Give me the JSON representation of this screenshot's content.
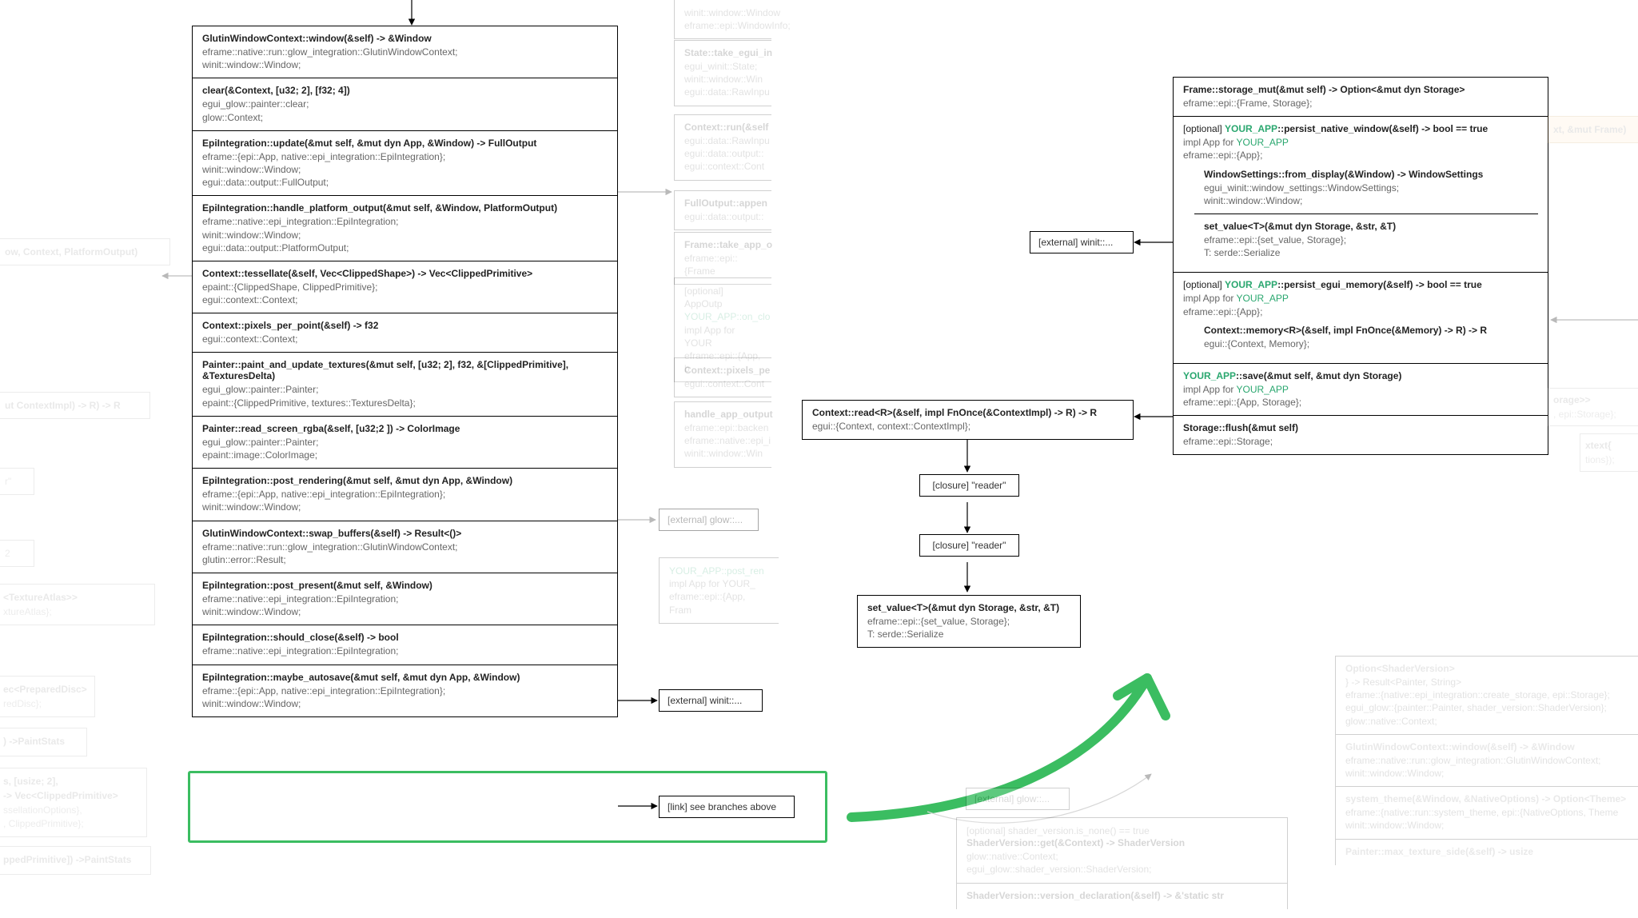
{
  "main_stack": {
    "cells": [
      {
        "sig": "GlutinWindowContext::window(&self) -> &Window",
        "details": [
          "eframe::native::run::glow_integration::GlutinWindowContext;",
          "winit::window::Window;"
        ]
      },
      {
        "sig": "clear(&Context, [u32; 2], [f32; 4])",
        "details": [
          "egui_glow::painter::clear;",
          "glow::Context;"
        ]
      },
      {
        "sig": "EpiIntegration::update(&mut self, &mut dyn App, &Window) -> FullOutput",
        "details": [
          "eframe::{epi::App, native::epi_integration::EpiIntegration};",
          "winit::window::Window;",
          "egui::data::output::FullOutput;"
        ]
      },
      {
        "sig": "EpiIntegration::handle_platform_output(&mut self, &Window, PlatformOutput)",
        "details": [
          "eframe::native::epi_integration::EpiIntegration;",
          "winit::window::Window;",
          "egui::data::output::PlatformOutput;"
        ]
      },
      {
        "sig": "Context::tessellate(&self, Vec<ClippedShape>) -> Vec<ClippedPrimitive>",
        "details": [
          "epaint::{ClippedShape, ClippedPrimitive};",
          "egui::context::Context;"
        ]
      },
      {
        "sig": "Context::pixels_per_point(&self) -> f32",
        "details": [
          "egui::context::Context;"
        ]
      },
      {
        "sig": "Painter::paint_and_update_textures(&mut self, [u32; 2], f32, &[ClippedPrimitive], &TexturesDelta)",
        "details": [
          "egui_glow::painter::Painter;",
          "epaint::{ClippedPrimitive, textures::TexturesDelta};"
        ]
      },
      {
        "sig": "Painter::read_screen_rgba(&self, [u32;2 ]) -> ColorImage",
        "details": [
          "egui_glow::painter::Painter;",
          "epaint::image::ColorImage;"
        ]
      },
      {
        "sig": "EpiIntegration::post_rendering(&mut self, &mut dyn App, &Window)",
        "details": [
          "eframe::{epi::App, native::epi_integration::EpiIntegration};",
          "winit::window::Window;"
        ]
      },
      {
        "sig": "GlutinWindowContext::swap_buffers(&self) -> Result<()>",
        "details": [
          "eframe::native::run::glow_integration::GlutinWindowContext;",
          "glutin::error::Result;"
        ]
      },
      {
        "sig": "EpiIntegration::post_present(&mut self, &Window)",
        "details": [
          "eframe::native::epi_integration::EpiIntegration;",
          "winit::window::Window;"
        ]
      },
      {
        "sig": "EpiIntegration::should_close(&self) -> bool",
        "details": [
          "eframe::native::epi_integration::EpiIntegration;"
        ]
      },
      {
        "sig": "EpiIntegration::maybe_autosave(&mut self, &mut dyn App, &Window)",
        "details": [
          "eframe::{epi::App, native::epi_integration::EpiIntegration};",
          "winit::window::Window;"
        ]
      }
    ]
  },
  "right_stack": {
    "cell0": {
      "sig": "Frame::storage_mut(&mut self) -> Option<&mut dyn Storage>",
      "details": [
        "eframe::epi::{Frame, Storage};"
      ]
    },
    "cell1": {
      "opt_prefix": "[optional] ",
      "app": "YOUR_APP",
      "tail": "::persist_native_window(&self) -> bool == true",
      "details": [
        "impl App for ",
        "eframe::epi::{App};"
      ]
    },
    "cell1b": {
      "sig": "WindowSettings::from_display(&Window) -> WindowSettings",
      "details": [
        "egui_winit::window_settings::WindowSettings;",
        "winit::window::Window;"
      ]
    },
    "cell1c": {
      "sig": "set_value<T>(&mut dyn Storage, &str, &T)",
      "details": [
        "eframe::epi::{set_value, Storage};",
        "T: serde::Serialize"
      ]
    },
    "cell2": {
      "opt_prefix": "[optional] ",
      "app": "YOUR_APP",
      "tail": "::persist_egui_memory(&self) -> bool == true",
      "details": [
        "impl App for ",
        "eframe::epi::{App};"
      ]
    },
    "cell2b": {
      "sig": "Context::memory<R>(&self, impl FnOnce(&Memory) -> R) -> R",
      "details": [
        "egui::{Context, Memory};"
      ]
    },
    "cell3": {
      "app": "YOUR_APP",
      "tail": "::save(&mut self, &mut dyn Storage)",
      "details": [
        "impl App for ",
        "eframe::epi::{App, Storage};"
      ]
    },
    "cell4": {
      "sig": "Storage::flush(&mut self)",
      "details": [
        "eframe::epi::Storage;"
      ]
    }
  },
  "mid_nodes": {
    "ext_winit1": "[external] winit::...",
    "ext_winit2": "[external] winit::...",
    "ext_glow": "[external] glow::...",
    "link_above": "[link] see branches above",
    "context_read": {
      "sig": "Context::read<R>(&self, impl FnOnce(&ContextImpl) -> R) -> R",
      "details": [
        "egui::{Context, context::ContextImpl};"
      ]
    },
    "closure1": "[closure] \"reader\"",
    "closure2": "[closure] \"reader\"",
    "set_value": {
      "sig": "set_value<T>(&mut dyn Storage, &str, &T)",
      "details": [
        "eframe::epi::{set_value, Storage};",
        "T: serde::Serialize"
      ]
    }
  },
  "faded_mid_column": {
    "a": [
      "winit::window::Window",
      "eframe::epi::WindowInfo;"
    ],
    "b": [
      "State::take_egui_in",
      "egui_winit::State;",
      "winit::window::Win",
      "egui::data::RawInpu"
    ],
    "c": [
      "Context::run(&self",
      "egui::data::RawInpu",
      "egui::data::output::",
      "egui::context::Cont"
    ],
    "d": [
      "FullOutput::appen",
      "egui::data::output::"
    ],
    "e": [
      "Frame::take_app_o",
      "eframe::epi::{Frame"
    ],
    "f": [
      "[optional] AppOutp",
      "YOUR_APP::on_clo",
      "impl App for YOUR",
      "eframe::epi::{App, b"
    ],
    "g": [
      "Context::pixels_pe",
      "egui::context::Cont"
    ],
    "h": [
      "handle_app_output",
      "eframe::epi::backen",
      "eframe::native::epi_i",
      "winit::window::Win"
    ],
    "i": [
      "YOUR_APP::post_ren",
      "impl App for YOUR_",
      "eframe::epi::{App, Fram"
    ]
  },
  "faded_left": {
    "a": "ow, Context, PlatformOutput)",
    "b": "ut ContextImpl) -> R) -> R",
    "c": "r\"",
    "d": "2",
    "e": [
      "<TextureAtlas>>",
      "xtureAtlas};"
    ],
    "f": [
      "ec<PreparedDisc>",
      "redDisc};"
    ],
    "g": [
      ") ->PaintStats"
    ],
    "h": [
      "s, [usize; 2],",
      "-> Vec<ClippedPrimitive>",
      "ssellationOptions},",
      ", ClippedPrimitive};"
    ],
    "i": [
      "ppedPrimitive]) ->PaintStats"
    ]
  },
  "faded_right": {
    "r0": "xt, &mut Frame)",
    "r1": [
      "orage>>",
      ", epi::Storage};"
    ],
    "r2": [
      "xtext{",
      "tions});"
    ],
    "a": [
      "        Option<ShaderVersion>",
      "} -> Result<Painter, String>",
      "eframe::{native::epi_integration::create_storage, epi::Storage};",
      "egui_glow::{painter::Painter, shader_version::ShaderVersion};",
      "glow::native::Context;"
    ],
    "b": [
      "GlutinWindowContext::window(&self) -> &Window",
      "eframe::native::run::glow_integration::GlutinWindowContext;",
      "winit::window::Window;"
    ],
    "c": [
      "system_theme(&Window, &NativeOptions) -> Option<Theme>",
      "eframe::{native::run::system_theme, epi::{NativeOptions, Theme",
      "winit::window::Window;"
    ],
    "d": [
      "Painter::max_texture_side(&self) -> usize"
    ]
  },
  "faded_bottom": {
    "glow": "[external] glow::...",
    "sv1": [
      "[optional] shader_version.is_none() == true",
      "ShaderVersion::get(&Context) -> ShaderVersion",
      "glow::native::Context;",
      "egui_glow::shader_version::ShaderVersion;"
    ],
    "sv2": [
      "ShaderVersion::version_declaration(&self) -> &'static str"
    ]
  }
}
